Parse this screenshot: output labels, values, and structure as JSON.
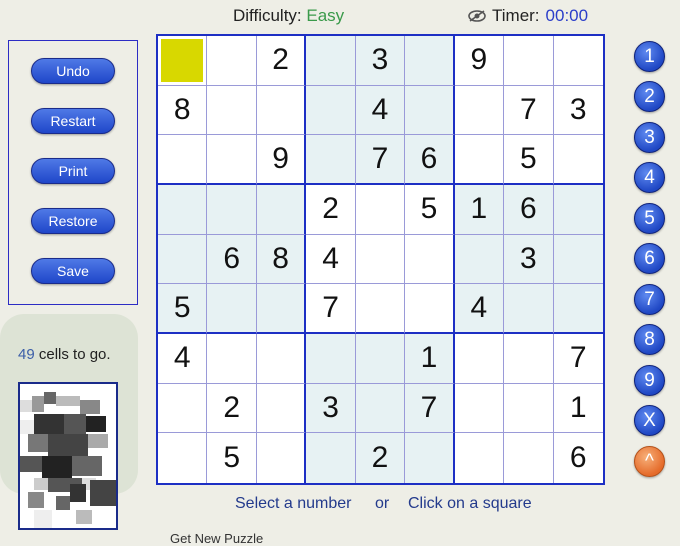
{
  "header": {
    "difficulty_label": "Difficulty:",
    "difficulty_value": "Easy",
    "timer_label": "Timer:",
    "timer_value": "00:00"
  },
  "controls": [
    "Undo",
    "Restart",
    "Print",
    "Restore",
    "Save"
  ],
  "status": {
    "cells_remaining": "49",
    "cells_text": "cells to go."
  },
  "grid": [
    [
      "",
      "",
      "2",
      "",
      "3",
      "",
      "9",
      "",
      ""
    ],
    [
      "8",
      "",
      "",
      "",
      "4",
      "",
      "",
      "7",
      "3"
    ],
    [
      "",
      "",
      "9",
      "",
      "7",
      "6",
      "",
      "5",
      ""
    ],
    [
      "",
      "",
      "",
      "2",
      "",
      "5",
      "1",
      "6",
      ""
    ],
    [
      "",
      "6",
      "8",
      "4",
      "",
      "",
      "",
      "3",
      ""
    ],
    [
      "5",
      "",
      "",
      "7",
      "",
      "",
      "4",
      "",
      ""
    ],
    [
      "4",
      "",
      "",
      "",
      "",
      "1",
      "",
      "",
      "7"
    ],
    [
      "",
      "2",
      "",
      "3",
      "",
      "7",
      "",
      "",
      "1"
    ],
    [
      "",
      "5",
      "",
      "",
      "2",
      "",
      "",
      "",
      "6"
    ]
  ],
  "selected_cell": {
    "row": 1,
    "col": 1
  },
  "palette": [
    "1",
    "2",
    "3",
    "4",
    "5",
    "6",
    "7",
    "8",
    "9",
    "X",
    "^"
  ],
  "footer": {
    "select_number": "Select a number",
    "or": "or",
    "click_square": "Click on a square",
    "truncated_link": "Get New Puzzle"
  },
  "colors": {
    "grid_border": "#1d2fc4",
    "tinted_box": "#e7f2f3",
    "selected_cell": "#d8d800",
    "difficulty": "#3a9a4a",
    "timer": "#2b3ec9"
  }
}
